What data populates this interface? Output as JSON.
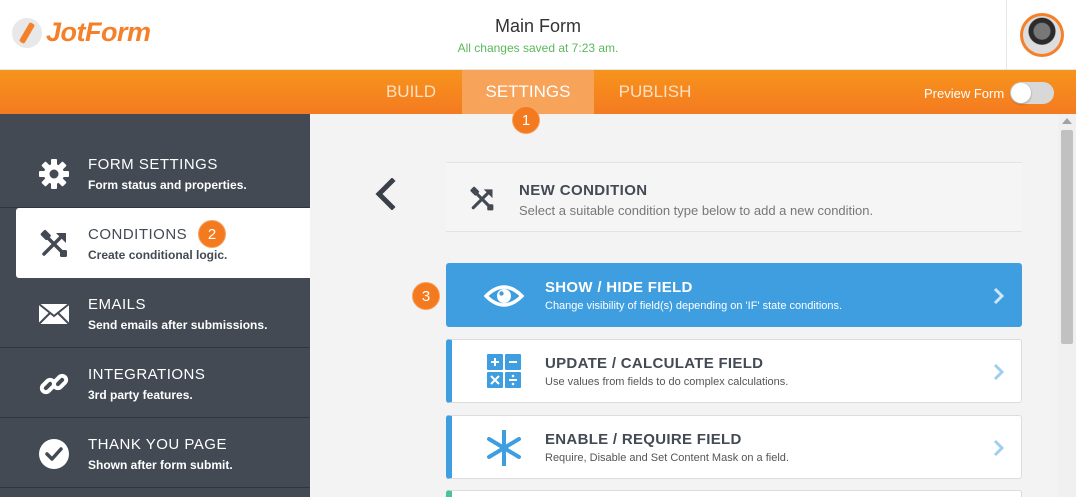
{
  "header": {
    "logo_text": "JotForm",
    "form_title": "Main Form",
    "save_status": "All changes saved at 7:23 am."
  },
  "nav": {
    "tabs": [
      {
        "label": "BUILD",
        "active": false
      },
      {
        "label": "SETTINGS",
        "active": true
      },
      {
        "label": "PUBLISH",
        "active": false
      }
    ],
    "preview_label": "Preview Form",
    "preview_on": false
  },
  "badges": [
    "1",
    "2",
    "3"
  ],
  "sidebar": {
    "items": [
      {
        "title": "FORM SETTINGS",
        "subtitle": "Form status and properties.",
        "icon": "gear-icon",
        "active": false
      },
      {
        "title": "CONDITIONS",
        "subtitle": "Create conditional logic.",
        "icon": "conditions-icon",
        "active": true
      },
      {
        "title": "EMAILS",
        "subtitle": "Send emails after submissions.",
        "icon": "envelope-icon",
        "active": false
      },
      {
        "title": "INTEGRATIONS",
        "subtitle": "3rd party features.",
        "icon": "chain-link-icon",
        "active": false
      },
      {
        "title": "THANK YOU PAGE",
        "subtitle": "Shown after form submit.",
        "icon": "check-circle-icon",
        "active": false
      }
    ]
  },
  "main": {
    "new_condition": {
      "title": "NEW CONDITION",
      "subtitle": "Select a suitable condition type below to add a new condition."
    },
    "condition_types": [
      {
        "title": "SHOW / HIDE FIELD",
        "subtitle": "Change visibility of field(s) depending on 'IF' state conditions.",
        "icon": "eye-icon",
        "active": true
      },
      {
        "title": "UPDATE / CALCULATE FIELD",
        "subtitle": "Use values from fields to do complex calculations.",
        "icon": "calculator-icon",
        "active": false
      },
      {
        "title": "ENABLE / REQUIRE FIELD",
        "subtitle": "Require, Disable and Set Content Mask on a field.",
        "icon": "asterisk-icon",
        "active": false
      }
    ]
  },
  "colors": {
    "accent_orange": "#f47a20",
    "active_blue": "#3f9ee0",
    "sidebar_dark": "#434a54",
    "saved_green": "#5cb85c"
  }
}
